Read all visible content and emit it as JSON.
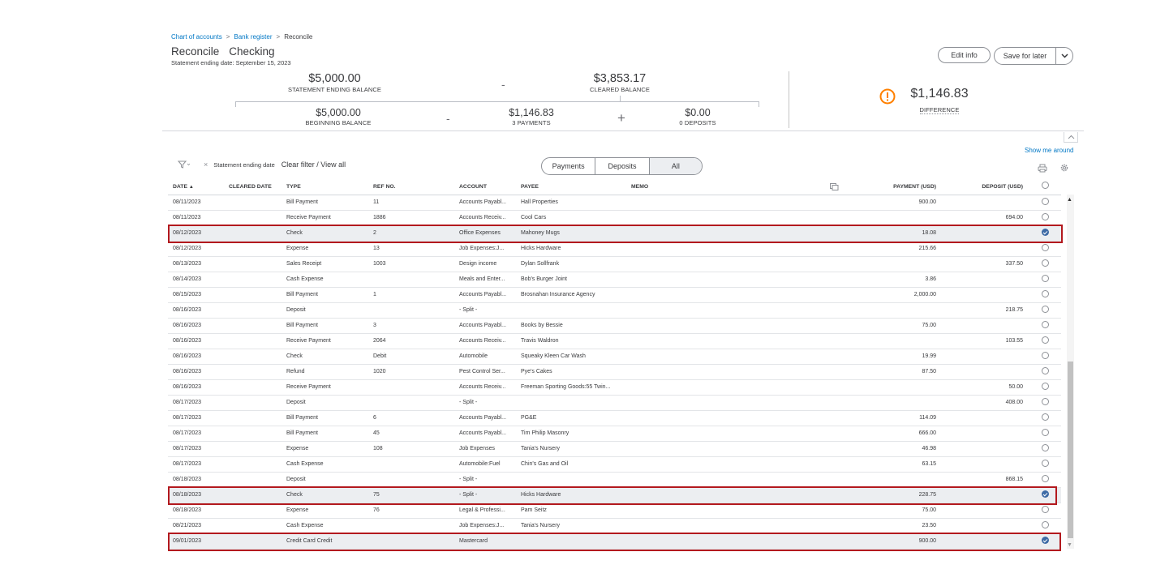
{
  "breadcrumb": {
    "items": [
      "Chart of accounts",
      "Bank register",
      "Reconcile"
    ],
    "separator": ">"
  },
  "header": {
    "title": "Reconcile",
    "account": "Checking",
    "subtitle": "Statement ending date: September 15, 2023",
    "edit_info": "Edit info",
    "save_for_later": "Save for later"
  },
  "summary": {
    "statement_ending_balance": {
      "value": "$5,000.00",
      "label": "STATEMENT ENDING BALANCE"
    },
    "minus1": "-",
    "cleared_balance": {
      "value": "$3,853.17",
      "label": "CLEARED BALANCE"
    },
    "beginning_balance": {
      "value": "$5,000.00",
      "label": "BEGINNING BALANCE"
    },
    "minus2": "-",
    "payments": {
      "value": "$1,146.83",
      "label": "3 PAYMENTS"
    },
    "plus": "+",
    "deposits": {
      "value": "$0.00",
      "label": "0 DEPOSITS"
    },
    "difference": {
      "value": "$1,146.83",
      "label": "DIFFERENCE"
    }
  },
  "toolbar": {
    "show_me_around": "Show me around",
    "filter_chip": "Statement ending date",
    "clear_filter": "Clear filter / View all",
    "tabs": [
      "Payments",
      "Deposits",
      "All"
    ],
    "active_tab": "All"
  },
  "columns": [
    "DATE",
    "CLEARED DATE",
    "TYPE",
    "REF NO.",
    "ACCOUNT",
    "PAYEE",
    "MEMO",
    "PAYMENT (USD)",
    "DEPOSIT (USD)"
  ],
  "sort_indicator": "▲",
  "rows": [
    {
      "date": "08/11/2023",
      "cleared": "",
      "type": "Bill Payment",
      "ref": "11",
      "account": "Accounts Payabl...",
      "payee": "Hall Properties",
      "memo": "",
      "payment": "900.00",
      "deposit": "",
      "checked": false
    },
    {
      "date": "08/11/2023",
      "cleared": "",
      "type": "Receive Payment",
      "ref": "1886",
      "account": "Accounts Receiv...",
      "payee": "Cool Cars",
      "memo": "",
      "payment": "",
      "deposit": "694.00",
      "checked": false
    },
    {
      "date": "08/12/2023",
      "cleared": "",
      "type": "Check",
      "ref": "2",
      "account": "Office Expenses",
      "payee": "Mahoney Mugs",
      "memo": "",
      "payment": "18.08",
      "deposit": "",
      "checked": true
    },
    {
      "date": "08/12/2023",
      "cleared": "",
      "type": "Expense",
      "ref": "13",
      "account": "Job Expenses:J...",
      "payee": "Hicks Hardware",
      "memo": "",
      "payment": "215.66",
      "deposit": "",
      "checked": false
    },
    {
      "date": "08/13/2023",
      "cleared": "",
      "type": "Sales Receipt",
      "ref": "1003",
      "account": "Design income",
      "payee": "Dylan Sollfrank",
      "memo": "",
      "payment": "",
      "deposit": "337.50",
      "checked": false
    },
    {
      "date": "08/14/2023",
      "cleared": "",
      "type": "Cash Expense",
      "ref": "",
      "account": "Meals and Enter...",
      "payee": "Bob's Burger Joint",
      "memo": "",
      "payment": "3.86",
      "deposit": "",
      "checked": false
    },
    {
      "date": "08/15/2023",
      "cleared": "",
      "type": "Bill Payment",
      "ref": "1",
      "account": "Accounts Payabl...",
      "payee": "Brosnahan Insurance Agency",
      "memo": "",
      "payment": "2,000.00",
      "deposit": "",
      "checked": false
    },
    {
      "date": "08/16/2023",
      "cleared": "",
      "type": "Deposit",
      "ref": "",
      "account": "- Split -",
      "payee": "",
      "memo": "",
      "payment": "",
      "deposit": "218.75",
      "checked": false
    },
    {
      "date": "08/16/2023",
      "cleared": "",
      "type": "Bill Payment",
      "ref": "3",
      "account": "Accounts Payabl...",
      "payee": "Books by Bessie",
      "memo": "",
      "payment": "75.00",
      "deposit": "",
      "checked": false
    },
    {
      "date": "08/16/2023",
      "cleared": "",
      "type": "Receive Payment",
      "ref": "2064",
      "account": "Accounts Receiv...",
      "payee": "Travis Waldron",
      "memo": "",
      "payment": "",
      "deposit": "103.55",
      "checked": false
    },
    {
      "date": "08/16/2023",
      "cleared": "",
      "type": "Check",
      "ref": "Debit",
      "account": "Automobile",
      "payee": "Squeaky Kleen Car Wash",
      "memo": "",
      "payment": "19.99",
      "deposit": "",
      "checked": false
    },
    {
      "date": "08/16/2023",
      "cleared": "",
      "type": "Refund",
      "ref": "1020",
      "account": "Pest Control Ser...",
      "payee": "Pye's Cakes",
      "memo": "",
      "payment": "87.50",
      "deposit": "",
      "checked": false
    },
    {
      "date": "08/16/2023",
      "cleared": "",
      "type": "Receive Payment",
      "ref": "",
      "account": "Accounts Receiv...",
      "payee": "Freeman Sporting Goods:55 Twin...",
      "memo": "",
      "payment": "",
      "deposit": "50.00",
      "checked": false
    },
    {
      "date": "08/17/2023",
      "cleared": "",
      "type": "Deposit",
      "ref": "",
      "account": "- Split -",
      "payee": "",
      "memo": "",
      "payment": "",
      "deposit": "408.00",
      "checked": false
    },
    {
      "date": "08/17/2023",
      "cleared": "",
      "type": "Bill Payment",
      "ref": "6",
      "account": "Accounts Payabl...",
      "payee": "PG&E",
      "memo": "",
      "payment": "114.09",
      "deposit": "",
      "checked": false
    },
    {
      "date": "08/17/2023",
      "cleared": "",
      "type": "Bill Payment",
      "ref": "45",
      "account": "Accounts Payabl...",
      "payee": "Tim Philip Masonry",
      "memo": "",
      "payment": "666.00",
      "deposit": "",
      "checked": false
    },
    {
      "date": "08/17/2023",
      "cleared": "",
      "type": "Expense",
      "ref": "108",
      "account": "Job Expenses",
      "payee": "Tania's Nursery",
      "memo": "",
      "payment": "46.98",
      "deposit": "",
      "checked": false
    },
    {
      "date": "08/17/2023",
      "cleared": "",
      "type": "Cash Expense",
      "ref": "",
      "account": "Automobile:Fuel",
      "payee": "Chin's Gas and Oil",
      "memo": "",
      "payment": "63.15",
      "deposit": "",
      "checked": false
    },
    {
      "date": "08/18/2023",
      "cleared": "",
      "type": "Deposit",
      "ref": "",
      "account": "- Split -",
      "payee": "",
      "memo": "",
      "payment": "",
      "deposit": "868.15",
      "checked": false
    },
    {
      "date": "08/18/2023",
      "cleared": "",
      "type": "Check",
      "ref": "75",
      "account": "- Split -",
      "payee": "Hicks Hardware",
      "memo": "",
      "payment": "228.75",
      "deposit": "",
      "checked": true
    },
    {
      "date": "08/18/2023",
      "cleared": "",
      "type": "Expense",
      "ref": "76",
      "account": "Legal & Professi...",
      "payee": "Pam Seitz",
      "memo": "",
      "payment": "75.00",
      "deposit": "",
      "checked": false
    },
    {
      "date": "08/21/2023",
      "cleared": "",
      "type": "Cash Expense",
      "ref": "",
      "account": "Job Expenses:J...",
      "payee": "Tania's Nursery",
      "memo": "",
      "payment": "23.50",
      "deposit": "",
      "checked": false
    },
    {
      "date": "09/01/2023",
      "cleared": "",
      "type": "Credit Card Credit",
      "ref": "",
      "account": "Mastercard",
      "payee": "",
      "memo": "",
      "payment": "900.00",
      "deposit": "",
      "checked": true
    }
  ],
  "colors": {
    "link": "#0077c5",
    "highlight": "#b3191e",
    "check": "#3d6aa5",
    "warning": "#ff8000"
  }
}
